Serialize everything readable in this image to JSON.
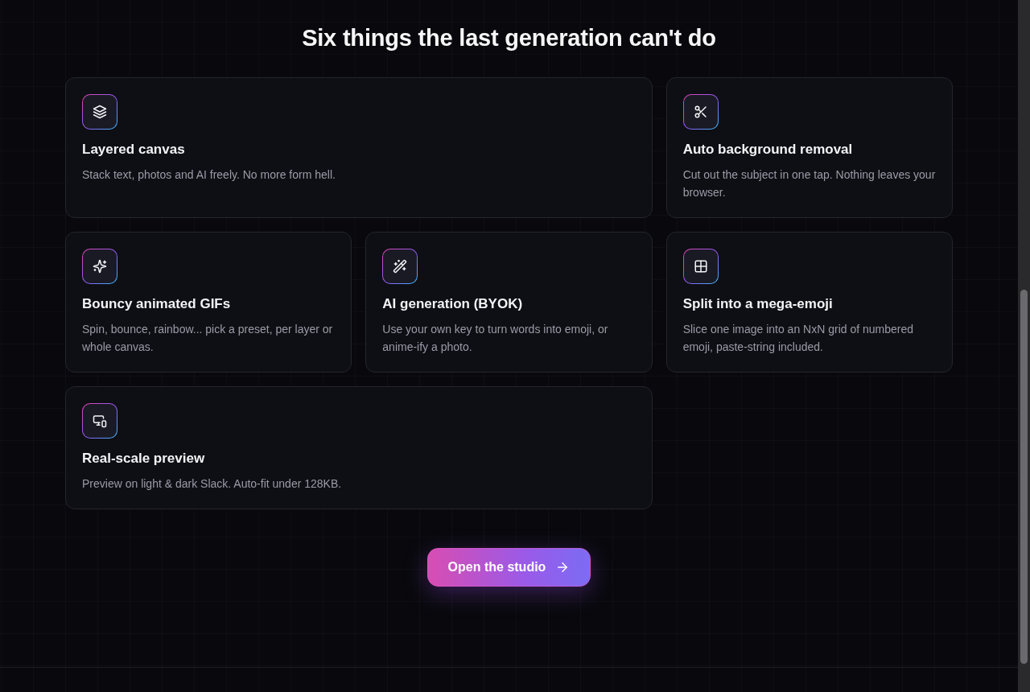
{
  "heading": "Six things the last generation can't do",
  "features": [
    {
      "title": "Layered canvas",
      "description": "Stack text, photos and AI freely. No more form hell."
    },
    {
      "title": "Auto background removal",
      "description": "Cut out the subject in one tap. Nothing leaves your browser."
    },
    {
      "title": "Bouncy animated GIFs",
      "description": "Spin, bounce, rainbow... pick a preset, per layer or whole canvas."
    },
    {
      "title": "AI generation (BYOK)",
      "description": "Use your own key to turn words into emoji, or anime-ify a photo."
    },
    {
      "title": "Split into a mega-emoji",
      "description": "Slice one image into an NxN grid of numbered emoji, paste-string included."
    },
    {
      "title": "Real-scale preview",
      "description": "Preview on light & dark Slack. Auto-fit under 128KB."
    }
  ],
  "cta": {
    "label": "Open the studio"
  }
}
